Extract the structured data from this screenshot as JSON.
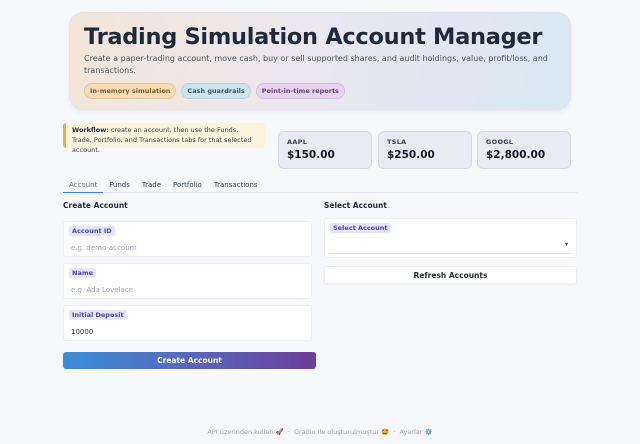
{
  "header": {
    "title": "Trading Simulation Account Manager",
    "description": "Create a paper-trading account, move cash, buy or sell supported shares, and audit holdings, value, profit/loss, and transactions.",
    "tags": [
      "In-memory simulation",
      "Cash guardrails",
      "Point-in-time reports"
    ]
  },
  "workflow": {
    "label": "Workflow:",
    "text": " create an account, then use the Funds, Trade, Portfolio, and Transactions tabs for that selected account."
  },
  "stocks": [
    {
      "symbol": "AAPL",
      "price": "$150.00"
    },
    {
      "symbol": "TSLA",
      "price": "$250.00"
    },
    {
      "symbol": "GOOGL",
      "price": "$2,800.00"
    }
  ],
  "tabs": [
    "Account",
    "Funds",
    "Trade",
    "Portfolio",
    "Transactions"
  ],
  "create_account": {
    "title": "Create Account",
    "fields": [
      {
        "label": "Account ID",
        "placeholder": "e.g. demo-account",
        "value": ""
      },
      {
        "label": "Name",
        "placeholder": "e.g. Ada Lovelace",
        "value": ""
      },
      {
        "label": "Initial Deposit",
        "placeholder": "",
        "value": "10000"
      }
    ],
    "button": "Create Account"
  },
  "select_account": {
    "title": "Select Account",
    "label": "Select Account",
    "caret": "▾",
    "refresh_button": "Refresh Accounts"
  },
  "footer": {
    "api": "API üzerinden kullan 🚀",
    "sep1": "·",
    "gradio": "Gradio ile oluşturulmuştur 🤩",
    "sep2": "·",
    "settings": "Ayarlar ⚙️"
  }
}
